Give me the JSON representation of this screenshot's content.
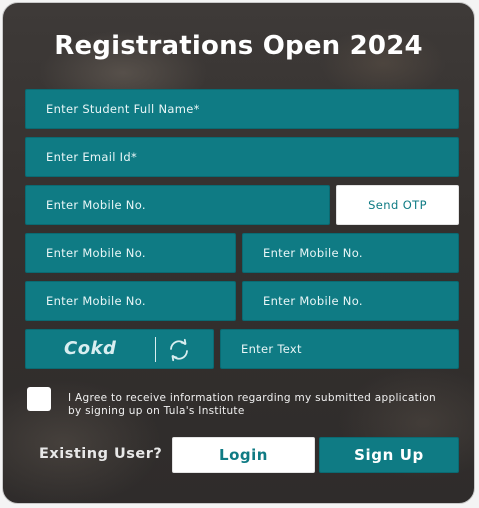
{
  "form": {
    "title": "Registrations Open 2024",
    "full_name_placeholder": "Enter Student Full Name*",
    "email_placeholder": "Enter Email Id*",
    "mobile_placeholder": "Enter Mobile No.",
    "send_otp_label": "Send OTP",
    "mobile_2_placeholder": "Enter Mobile No.",
    "mobile_3_placeholder": "Enter Mobile No.",
    "mobile_4_placeholder": "Enter Mobile No.",
    "mobile_5_placeholder": "Enter Mobile No.",
    "captcha_code": "Cokd",
    "captcha_input_placeholder": "Enter Text",
    "consent_text": "I Agree to receive information regarding my submitted application by signing up on Tula's Institute",
    "existing_user_label": "Existing User?",
    "login_label": "Login",
    "signup_label": "Sign Up"
  },
  "icons": {
    "refresh": "refresh-icon"
  },
  "colors": {
    "teal": "#0f7b84",
    "white": "#ffffff",
    "background": "#34302e"
  }
}
